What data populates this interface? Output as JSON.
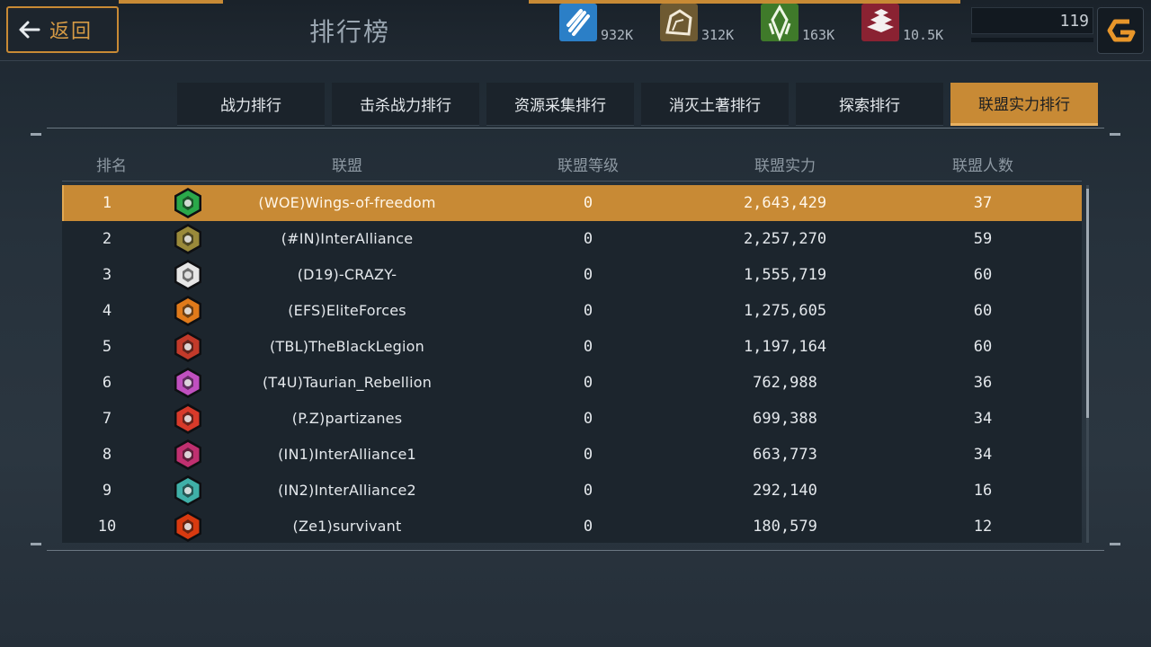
{
  "header": {
    "back_label": "返回",
    "title": "排行榜",
    "level": "119"
  },
  "resources": [
    {
      "name": "energy",
      "icon": "lightning-icon",
      "value": "932K",
      "color": "#2b7fc7"
    },
    {
      "name": "stone",
      "icon": "rock-icon",
      "value": "312K",
      "color": "#6e5a32"
    },
    {
      "name": "crystal",
      "icon": "crystal-icon",
      "value": "163K",
      "color": "#3f7a2a"
    },
    {
      "name": "metal",
      "icon": "ingot-icon",
      "value": "10.5K",
      "color": "#8a2232"
    }
  ],
  "tabs": [
    {
      "label": "战力排行",
      "active": false
    },
    {
      "label": "击杀战力排行",
      "active": false
    },
    {
      "label": "资源采集排行",
      "active": false
    },
    {
      "label": "消灭土著排行",
      "active": false
    },
    {
      "label": "探索排行",
      "active": false
    },
    {
      "label": "联盟实力排行",
      "active": true
    }
  ],
  "table": {
    "columns": [
      "排名",
      "联盟",
      "联盟等级",
      "联盟实力",
      "联盟人数"
    ],
    "rows": [
      {
        "rank": "1",
        "alliance": "(WOE)Wings-of-freedom",
        "level": "0",
        "power": "2,643,429",
        "members": "37",
        "emblem": "green-shield-emblem-icon",
        "emblem_color": "#2aa84a"
      },
      {
        "rank": "2",
        "alliance": "(#IN)InterAlliance",
        "level": "0",
        "power": "2,257,270",
        "members": "59",
        "emblem": "gold-hex-emblem-icon",
        "emblem_color": "#9a8a3a"
      },
      {
        "rank": "3",
        "alliance": "(D19)-CRAZY-",
        "level": "0",
        "power": "1,555,719",
        "members": "60",
        "emblem": "white-chevron-emblem-icon",
        "emblem_color": "#e6e6e6"
      },
      {
        "rank": "4",
        "alliance": "(EFS)EliteForces",
        "level": "0",
        "power": "1,275,605",
        "members": "60",
        "emblem": "orange-wing-emblem-icon",
        "emblem_color": "#e07a1a"
      },
      {
        "rank": "5",
        "alliance": "(TBL)TheBlackLegion",
        "level": "0",
        "power": "1,197,164",
        "members": "60",
        "emblem": "red-ship-emblem-icon",
        "emblem_color": "#c23a2a"
      },
      {
        "rank": "6",
        "alliance": "(T4U)Taurian_Rebellion",
        "level": "0",
        "power": "762,988",
        "members": "36",
        "emblem": "pink-star-emblem-icon",
        "emblem_color": "#c050c0"
      },
      {
        "rank": "7",
        "alliance": "(P.Z)partizanes",
        "level": "0",
        "power": "699,388",
        "members": "34",
        "emblem": "red-triangle-emblem-icon",
        "emblem_color": "#d83a2a"
      },
      {
        "rank": "8",
        "alliance": "(IN1)InterAlliance1",
        "level": "0",
        "power": "663,773",
        "members": "34",
        "emblem": "magenta-globe-emblem-icon",
        "emblem_color": "#c03070"
      },
      {
        "rank": "9",
        "alliance": "(IN2)InterAlliance2",
        "level": "0",
        "power": "292,140",
        "members": "16",
        "emblem": "teal-orb-emblem-icon",
        "emblem_color": "#3fb0a8"
      },
      {
        "rank": "10",
        "alliance": "(Ze1)survivant",
        "level": "0",
        "power": "180,579",
        "members": "12",
        "emblem": "fire-emblem-icon",
        "emblem_color": "#d83a10"
      }
    ]
  }
}
